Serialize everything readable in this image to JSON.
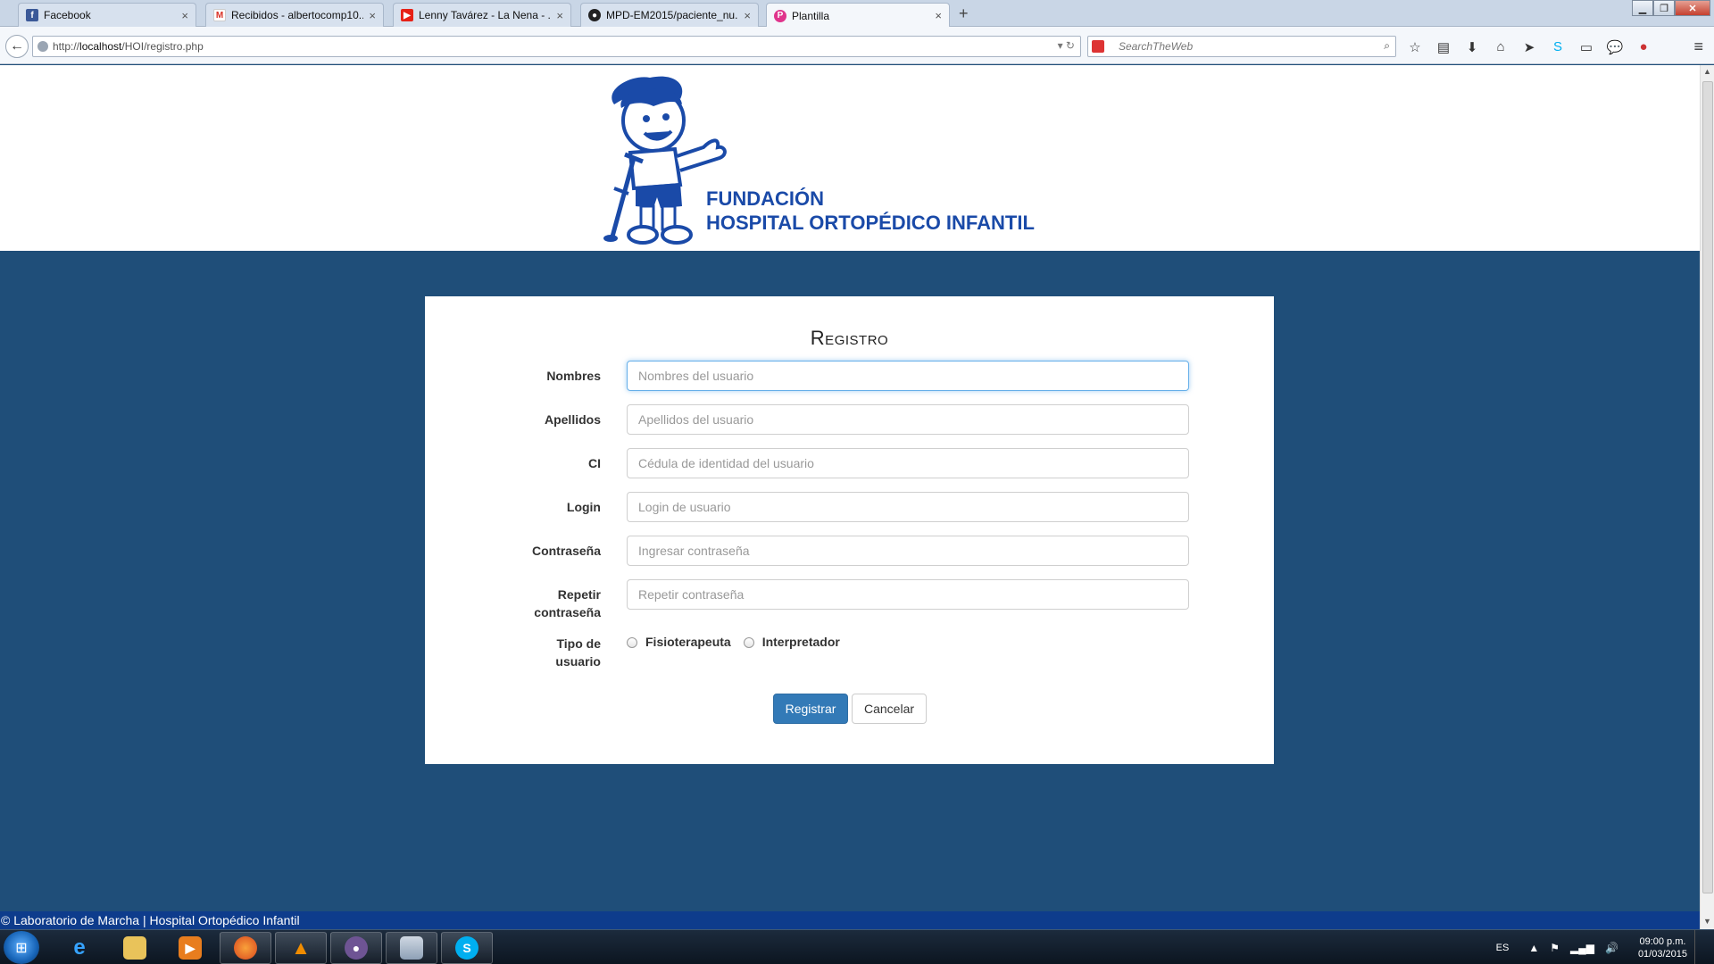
{
  "browser": {
    "tabs": [
      {
        "label": "Facebook",
        "icon": "facebook-icon",
        "color": "#3b5998"
      },
      {
        "label": "Recibidos - albertocomp10...",
        "icon": "gmail-icon",
        "color": "#d93025"
      },
      {
        "label": "Lenny Tavárez - La Nena - ...",
        "icon": "youtube-icon",
        "color": "#e62117"
      },
      {
        "label": "MPD-EM2015/paciente_nu...",
        "icon": "github-icon",
        "color": "#222222"
      },
      {
        "label": "Plantilla",
        "icon": "plantilla-icon",
        "color": "#e0348c"
      }
    ],
    "url_prefix": "http://",
    "url_host": "localhost",
    "url_path": "/HOI/registro.php",
    "search_placeholder": "SearchTheWeb"
  },
  "header": {
    "logo_line1": "FUNDACIÓN",
    "logo_line2": "HOSPITAL ORTOPÉDICO INFANTIL"
  },
  "form": {
    "title": "Registro",
    "fields": [
      {
        "label": "Nombres",
        "placeholder": "Nombres del usuario"
      },
      {
        "label": "Apellidos",
        "placeholder": "Apellidos del usuario"
      },
      {
        "label": "CI",
        "placeholder": "Cédula de identidad del usuario"
      },
      {
        "label": "Login",
        "placeholder": "Login de usuario"
      },
      {
        "label": "Contraseña",
        "placeholder": "Ingresar contraseña"
      },
      {
        "label": "Repetir contraseña",
        "placeholder": "Repetir contraseña"
      }
    ],
    "user_type_label": "Tipo de usuario",
    "user_type_options": [
      "Fisioterapeuta",
      "Interpretador"
    ],
    "submit_label": "Registrar",
    "cancel_label": "Cancelar"
  },
  "footer": {
    "text": "© Laboratorio de Marcha | Hospital Ortopédico Infantil"
  },
  "taskbar": {
    "lang": "ES",
    "time": "09:00 p.m.",
    "date": "01/03/2015"
  },
  "colors": {
    "page_bg": "#1f4e79",
    "primary_button": "#337ab7",
    "footer_bg": "#0e3c8c",
    "logo_blue": "#1a4aa8"
  }
}
